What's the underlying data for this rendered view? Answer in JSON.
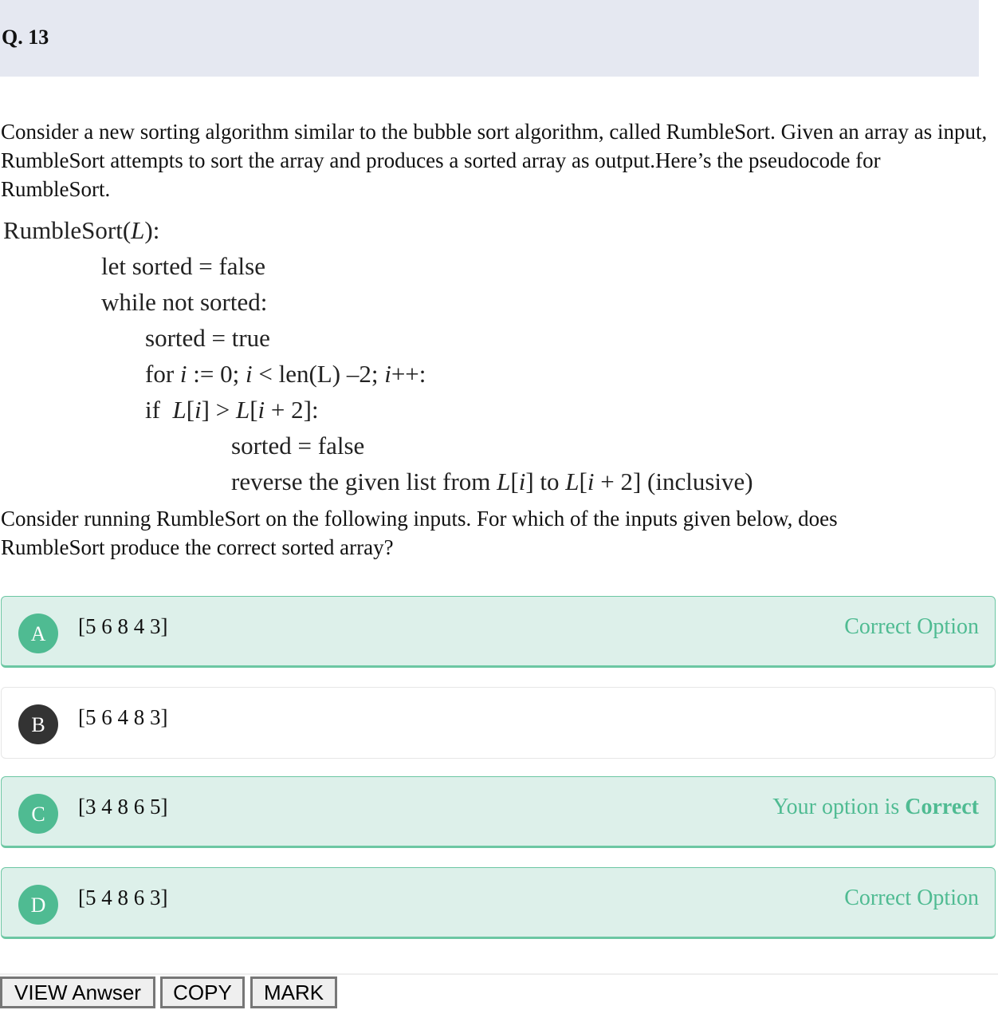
{
  "question": {
    "number": "Q. 13",
    "intro": "Consider a new sorting algorithm similar to the bubble sort algorithm, called RumbleSort. Given an array as input, RumbleSort attempts to sort the array and produces a sorted array as output.Here’s the pseudocode for RumbleSort.",
    "pseudocode": [
      {
        "indent": 0,
        "segments": [
          {
            "t": "RumbleSort("
          },
          {
            "t": "L",
            "i": true
          },
          {
            "t": "):"
          }
        ]
      },
      {
        "indent": 1,
        "segments": [
          {
            "t": "let sorted = false"
          }
        ]
      },
      {
        "indent": 1,
        "segments": [
          {
            "t": "while not sorted:"
          }
        ]
      },
      {
        "indent": 2,
        "segments": [
          {
            "t": "sorted = true"
          }
        ]
      },
      {
        "indent": 2,
        "segments": [
          {
            "t": "for "
          },
          {
            "t": "i",
            "i": true
          },
          {
            "t": " := 0; "
          },
          {
            "t": "i",
            "i": true
          },
          {
            "t": " < len(L) –2; "
          },
          {
            "t": "i",
            "i": true
          },
          {
            "t": "++:"
          }
        ]
      },
      {
        "indent": 2,
        "segments": [
          {
            "t": "if  "
          },
          {
            "t": "L",
            "i": true
          },
          {
            "t": "["
          },
          {
            "t": "i",
            "i": true
          },
          {
            "t": "] > "
          },
          {
            "t": "L",
            "i": true
          },
          {
            "t": "["
          },
          {
            "t": "i",
            "i": true
          },
          {
            "t": " + 2]:"
          }
        ]
      },
      {
        "indent": 3,
        "segments": [
          {
            "t": "sorted = false"
          }
        ]
      },
      {
        "indent": 3,
        "segments": [
          {
            "t": "reverse the given list from "
          },
          {
            "t": "L",
            "i": true
          },
          {
            "t": "["
          },
          {
            "t": "i",
            "i": true
          },
          {
            "t": "] to "
          },
          {
            "t": "L",
            "i": true
          },
          {
            "t": "["
          },
          {
            "t": "i",
            "i": true
          },
          {
            "t": " + 2] (inclusive)"
          }
        ]
      }
    ],
    "prompt": "Consider running RumbleSort on the following inputs. For which of the inputs given below, does RumbleSort produce the correct sorted array?"
  },
  "options": [
    {
      "letter": "A",
      "text": "[5 6 8 4 3]",
      "status": "correct",
      "label": "Correct Option"
    },
    {
      "letter": "B",
      "text": "[5 6 4 8 3]",
      "status": "plain",
      "label": ""
    },
    {
      "letter": "C",
      "text": "[3 4 8 6 5]",
      "status": "correct",
      "label_prefix": "Your option is ",
      "label_strong": "Correct"
    },
    {
      "letter": "D",
      "text": "[5 4 8 6 3]",
      "status": "correct",
      "label": "Correct Option"
    }
  ],
  "buttons": {
    "view": "VIEW Anwser",
    "copy": "COPY",
    "mark": "MARK"
  },
  "colors": {
    "accent": "#4fbb92",
    "correct_bg": "#ddf0ea",
    "header_bg": "#e5e8f1"
  }
}
